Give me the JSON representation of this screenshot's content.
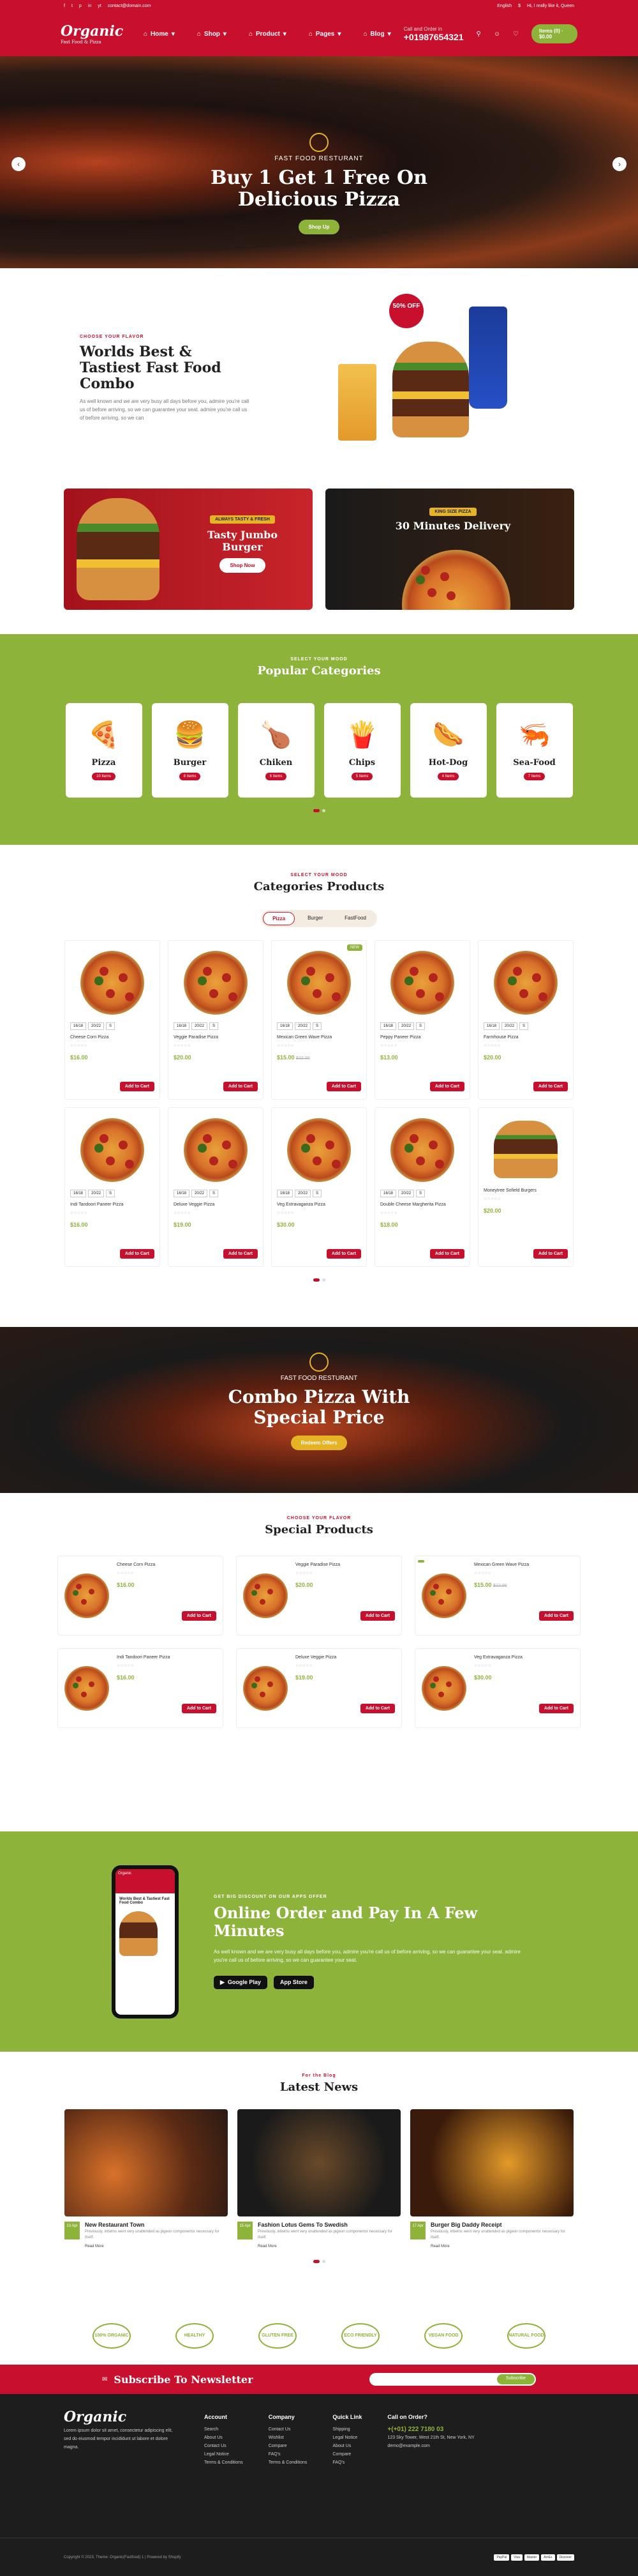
{
  "topbar": {
    "social": [
      "f",
      "t",
      "p",
      "in",
      "yt"
    ],
    "email": "contact@domain.com",
    "lang": "English",
    "currency": "$",
    "greeting": "Hi, I really like it, Queen"
  },
  "header": {
    "logo": "Organic",
    "logo_sub": "Fast Food & Pizza",
    "nav": [
      "Home",
      "Shop",
      "Product",
      "Pages",
      "Blog"
    ],
    "call_label": "Call and Order in",
    "phone": "+01987654321",
    "cart": "Items (0) · $0.00"
  },
  "hero": {
    "sub": "FAST FOOD RESTURANT",
    "title": "Buy 1 Get 1 Free On Delicious Pizza",
    "button": "Shop Up"
  },
  "combo": {
    "label": "CHOOSE YOUR FLAVOR",
    "title": "Worlds Best & Tastiest Fast Food Combo",
    "text": "As well known and we are very busy all days before you, admire you're call us of before arriving, so we can guarantee your seat. admire you're call us of before arriving, so we can",
    "sale": "50% OFF"
  },
  "promos": [
    {
      "tag": "ALWAYS TASTY & FRESH",
      "title": "Tasty Jumbo Burger",
      "button": "Shop Now"
    },
    {
      "tag": "KING SIZE PIZZA",
      "title": "30 Minutes Delivery"
    }
  ],
  "categories": {
    "label": "SELECT YOUR MOOD",
    "title": "Popular Categories",
    "items": [
      {
        "name": "Pizza",
        "icon": "🍕",
        "count": "10 Items"
      },
      {
        "name": "Burger",
        "icon": "🍔",
        "count": "8 Items"
      },
      {
        "name": "Chiken",
        "icon": "🍗",
        "count": "6 Items"
      },
      {
        "name": "Chips",
        "icon": "🍟",
        "count": "5 Items"
      },
      {
        "name": "Hot-Dog",
        "icon": "🌭",
        "count": "4 Items"
      },
      {
        "name": "Sea-Food",
        "icon": "🦐",
        "count": "7 Items"
      }
    ]
  },
  "products": {
    "label": "SELECT YOUR MOOD",
    "title": "Categories Products",
    "tabs": [
      "Pizza",
      "Burger",
      "FastFood"
    ],
    "add": "Add to Cart",
    "items": [
      {
        "name": "Cheese Corn Pizza",
        "price": "$16.00",
        "old": "",
        "badge": ""
      },
      {
        "name": "Veggie Paradise Pizza",
        "price": "$20.00",
        "old": "",
        "badge": ""
      },
      {
        "name": "Mexican Green Wave Pizza",
        "price": "$15.00",
        "old": "$22.00",
        "badge": "NEW"
      },
      {
        "name": "Peppy Paneer Pizza",
        "price": "$13.00",
        "old": "",
        "badge": ""
      },
      {
        "name": "Farmhouse Pizza",
        "price": "$20.00",
        "old": "",
        "badge": ""
      },
      {
        "name": "Indi Tandoori Paneer Pizza",
        "price": "$16.00",
        "old": "",
        "badge": ""
      },
      {
        "name": "Deluxe Veggie Pizza",
        "price": "$19.00",
        "old": "",
        "badge": ""
      },
      {
        "name": "Veg Extravaganza Pizza",
        "price": "$30.00",
        "old": "",
        "badge": ""
      },
      {
        "name": "Double Cheese Margherita Pizza",
        "price": "$18.00",
        "old": "",
        "badge": ""
      },
      {
        "name": "Moneytree Sofield Burgers",
        "price": "$20.00",
        "old": "",
        "badge": "",
        "burger": true
      }
    ]
  },
  "combo2": {
    "sub": "FAST FOOD RESTURANT",
    "title": "Combo Pizza With Special Price",
    "button": "Redeem Offers"
  },
  "special": {
    "label": "CHOOSE YOUR FLAVOR",
    "title": "Special Products",
    "items": [
      {
        "name": "Cheese Corn Pizza",
        "price": "$16.00",
        "old": ""
      },
      {
        "name": "Veggie Paradise Pizza",
        "price": "$20.00",
        "old": ""
      },
      {
        "name": "Mexican Green Wave Pizza",
        "price": "$15.00",
        "old": "$22.00"
      },
      {
        "name": "Indi Tandoori Paneer Pizza",
        "price": "$16.00",
        "old": ""
      },
      {
        "name": "Deluxe Veggie Pizza",
        "price": "$19.00",
        "old": ""
      },
      {
        "name": "Veg Extravaganza Pizza",
        "price": "$30.00",
        "old": ""
      }
    ]
  },
  "app": {
    "label": "GET BIG DISCOUNT ON OUR APPS OFFER",
    "title": "Online Order and Pay In A Few Minutes",
    "text": "As well known and we are very busy all days before you, admire you're call us of before arriving, so we can guarantee your seat. admire you're call us of before arriving, so we can guarantee your seat.",
    "stores": [
      "Google Play",
      "App Store"
    ],
    "phone_title": "Worlds Best & Tastiest Fast Food Combo"
  },
  "news": {
    "label": "For the Blog",
    "title": "Latest News",
    "read": "Read More",
    "items": [
      {
        "date": "13 Apr",
        "title": "New Restaurant Town",
        "desc": "Previously, inbetns went very unattended as pigeon componentsr necessary for itself."
      },
      {
        "date": "15 Apr",
        "title": "Fashion Lotus Gems To Swedish",
        "desc": "Previously, inbetns went very unattended as pigeon componentsr necessary for itself."
      },
      {
        "date": "17 Apr",
        "title": "Burger Big Daddy Receipt",
        "desc": "Previously, inbetns went very unattended as pigeon componentsr necessary for itself."
      }
    ]
  },
  "badges": [
    "100% ORGANIC",
    "HEALTHY",
    "GLUTEN FREE",
    "ECO FRIENDLY",
    "VEGAN FOOD",
    "NATURAL FOOD"
  ],
  "newsletter": {
    "title": "Subscribe To Newsletter",
    "placeholder": "Your email here",
    "button": "Subscribe"
  },
  "footer": {
    "about": "Lorem ipsum dolor sit amet, consectetur adipiscing elit, sed do eiusmod tempor incididunt ut labore et dolore magna.",
    "cols": [
      {
        "h": "Account",
        "items": [
          "Search",
          "About Us",
          "Contact Us",
          "Legal Notice",
          "Terms & Conditions"
        ]
      },
      {
        "h": "Company",
        "items": [
          "Contact Us",
          "Wishlist",
          "Compare",
          "FAQ's",
          "Terms & Conditions"
        ]
      },
      {
        "h": "Quick Link",
        "items": [
          "Shipping",
          "Legal Notice",
          "About Us",
          "Compare",
          "FAQ's"
        ]
      }
    ],
    "call": "Call on Order?",
    "phone": "+(+01) 222 7180 03",
    "address": "123 Sky Tower, West 21th St, New York, NY",
    "email": "demo@example.com",
    "copy": "Copyright © 2023, Theme: Organic(Fastfood) 1 | Powered by Shopify",
    "pay": [
      "PayPal",
      "Visa",
      "Master",
      "AmEx",
      "Discover"
    ]
  }
}
